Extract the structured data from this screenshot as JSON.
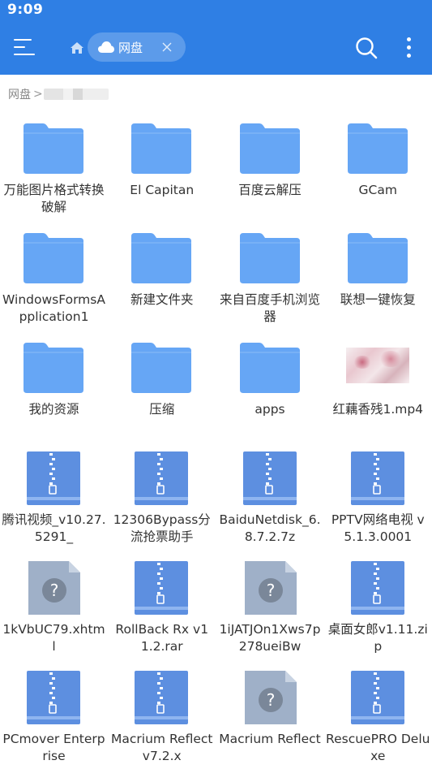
{
  "status": {
    "time": "9:09"
  },
  "toolbar": {
    "tab_label": "网盘"
  },
  "breadcrumb": {
    "root": "网盘",
    "separator": ">"
  },
  "colors": {
    "header": "#2f7fe4",
    "folder": "#66a6f5",
    "archive": "#5d8fe0",
    "unknown": "#9fb0c8"
  },
  "items": [
    {
      "name": "万能图片格式转换破解",
      "type": "folder"
    },
    {
      "name": "El Capitan",
      "type": "folder"
    },
    {
      "name": "百度云解压",
      "type": "folder"
    },
    {
      "name": "GCam",
      "type": "folder"
    },
    {
      "name": "WindowsFormsApplication1",
      "type": "folder"
    },
    {
      "name": "新建文件夹",
      "type": "folder"
    },
    {
      "name": "来自百度手机浏览器",
      "type": "folder"
    },
    {
      "name": "联想一键恢复",
      "type": "folder"
    },
    {
      "name": "我的资源",
      "type": "folder"
    },
    {
      "name": "压缩",
      "type": "folder"
    },
    {
      "name": "apps",
      "type": "folder"
    },
    {
      "name": "红藕香残1.mp4",
      "type": "video"
    },
    {
      "name": "腾讯视频_v10.27.5291_",
      "type": "archive"
    },
    {
      "name": "12306Bypass分流抢票助手",
      "type": "archive"
    },
    {
      "name": "BaiduNetdisk_6.8.7.2.7z",
      "type": "archive"
    },
    {
      "name": "PPTV网络电视 v5.1.3.0001",
      "type": "archive"
    },
    {
      "name": "1kVbUC79.xhtml",
      "type": "unknown"
    },
    {
      "name": "RollBack Rx v11.2.rar",
      "type": "archive"
    },
    {
      "name": "1iJATJOn1Xws7p278ueiBw",
      "type": "unknown"
    },
    {
      "name": "桌面女郎v1.11.zip",
      "type": "archive"
    },
    {
      "name": "PCmover Enterprise",
      "type": "archive"
    },
    {
      "name": "Macrium Reflect v7.2.x",
      "type": "archive"
    },
    {
      "name": "Macrium Reflect",
      "type": "unknown"
    },
    {
      "name": "RescuePRO Deluxe",
      "type": "archive"
    }
  ]
}
